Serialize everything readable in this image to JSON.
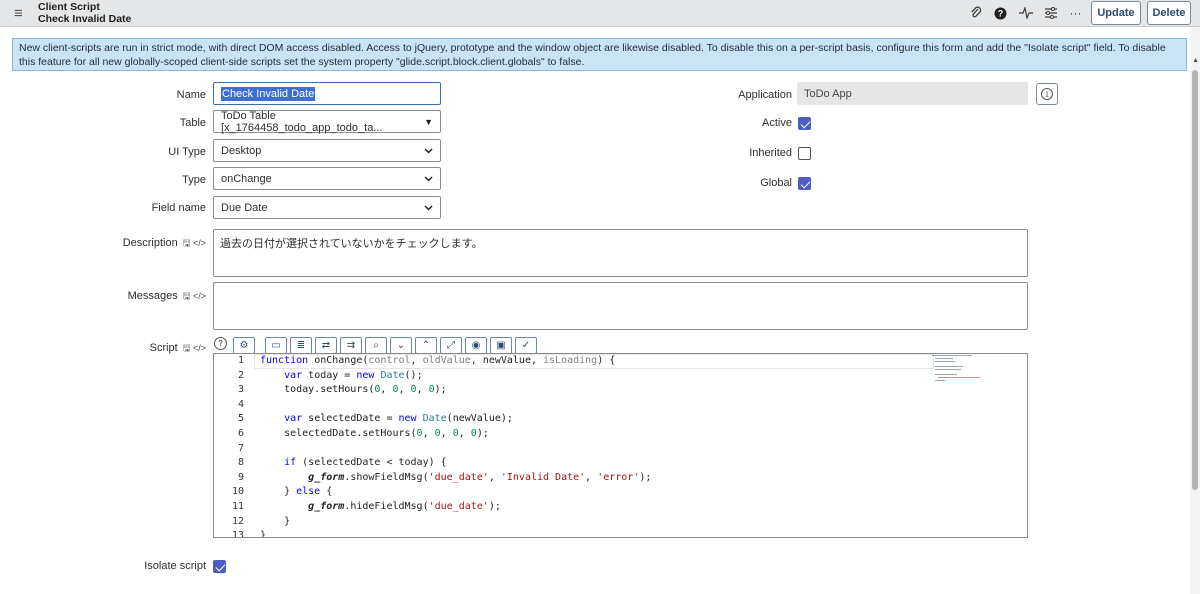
{
  "header": {
    "title_line1": "Client Script",
    "title_line2": "Check Invalid Date",
    "update_label": "Update",
    "delete_label": "Delete",
    "icons": [
      "menu-icon",
      "attachment-icon",
      "help-icon",
      "activity-icon",
      "settings-icon",
      "more-icon"
    ]
  },
  "info_message": "New client-scripts are run in strict mode, with direct DOM access disabled. Access to jQuery, prototype and the window object are likewise disabled. To disable this on a per-script basis, configure this form and add the \"Isolate script\" field. To disable this feature for all new globally-scoped client-side scripts set the system property \"glide.script.block.client.globals\" to false.",
  "form": {
    "name_label": "Name",
    "name_value": "Check Invalid Date",
    "table_label": "Table",
    "table_value": "ToDo Table [x_1764458_todo_app_todo_ta...",
    "ui_type_label": "UI Type",
    "ui_type_value": "Desktop",
    "type_label": "Type",
    "type_value": "onChange",
    "field_name_label": "Field name",
    "field_name_value": "Due Date",
    "description_label": "Description",
    "description_value": "過去の日付が選択されていないかをチェックします。",
    "messages_label": "Messages",
    "messages_value": "",
    "script_label": "Script",
    "application_label": "Application",
    "application_value": "ToDo App",
    "active_label": "Active",
    "active_checked": true,
    "inherited_label": "Inherited",
    "inherited_checked": false,
    "global_label": "Global",
    "global_checked": true,
    "isolate_label": "Isolate script",
    "isolate_checked": true
  },
  "script": {
    "line_numbers": [
      "1",
      "2",
      "3",
      "4",
      "5",
      "6",
      "7",
      "8",
      "9",
      "10",
      "11",
      "12",
      "13"
    ],
    "lines": [
      "function onChange(control, oldValue, newValue, isLoading) {",
      "    var today = new Date();",
      "    today.setHours(0, 0, 0, 0);",
      "",
      "    var selectedDate = new Date(newValue);",
      "    selectedDate.setHours(0, 0, 0, 0);",
      "",
      "    if (selectedDate < today) {",
      "        g_form.showFieldMsg('due_date', 'Invalid Date', 'error');",
      "    } else {",
      "        g_form.hideFieldMsg('due_date');",
      "    }",
      "}"
    ]
  },
  "toolbar_icons": [
    "toggle-syntax-icon",
    "comment-icon",
    "format-icon",
    "replace-icon",
    "replace-all-icon",
    "search-icon",
    "fold-down-icon",
    "fold-up-icon",
    "fullscreen-icon",
    "script-debugger-icon",
    "save-icon",
    "check-syntax-icon"
  ]
}
